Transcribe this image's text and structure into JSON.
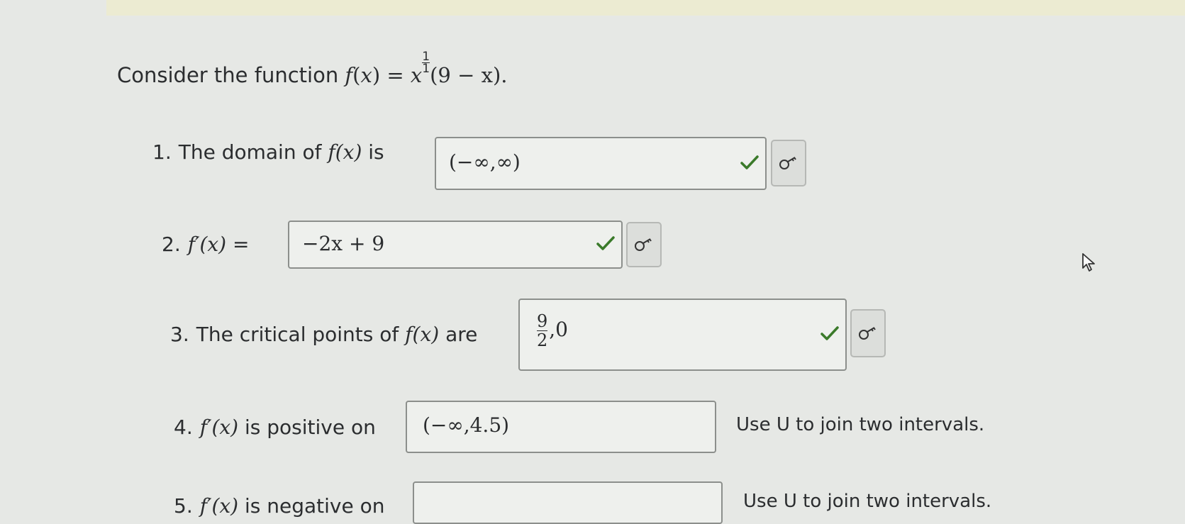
{
  "prompt": {
    "lead": "Consider the function",
    "f": "f",
    "open": "(",
    "x": "x",
    "close_eq": ") = ",
    "base": "x",
    "exp_num": "1",
    "exp_den": "1",
    "tail": "(9 − x)."
  },
  "questions": [
    {
      "num": "1.",
      "text_a": "The domain of",
      "fn": "f(x)",
      "text_b": "is",
      "answer": "(−∞,∞)",
      "status": "correct"
    },
    {
      "num": "2.",
      "fn": "f′(x) =",
      "answer": "−2x + 9",
      "status": "correct"
    },
    {
      "num": "3.",
      "text_a": "The critical points of",
      "fn": "f(x)",
      "text_b": "are",
      "answer_num": "9",
      "answer_den": "2",
      "answer_tail": ",0",
      "status": "correct"
    },
    {
      "num": "4.",
      "fn": "f′(x)",
      "text_b": "is positive on",
      "answer": "(−∞,4.5)",
      "hint": "Use U to join two intervals."
    },
    {
      "num": "5.",
      "fn": "f′(x)",
      "text_b": "is negative on",
      "answer": "",
      "hint": "Use U to join two intervals."
    }
  ],
  "icons": {
    "check": "check-icon",
    "key": "key-icon",
    "cursor": "mouse-cursor-icon"
  },
  "colors": {
    "check": "#3a7a2a",
    "background": "#e6e8e5"
  }
}
